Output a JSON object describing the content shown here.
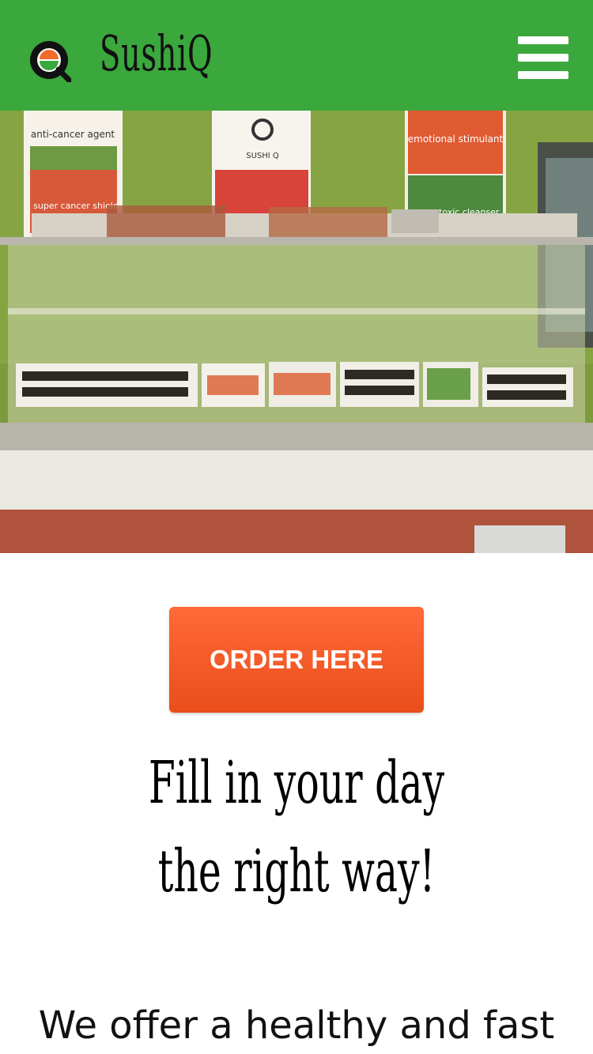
{
  "header": {
    "brand": "SushiQ",
    "logo_icon": "sushi-q-logo-icon",
    "menu_icon": "hamburger-menu-icon",
    "background_color": "#3aa83c"
  },
  "hero": {
    "image": "sushi-display-case-photo",
    "poster_texts": [
      "anti-cancer agent",
      "super cancer shield",
      "SUSHI Q",
      "emotional stimulant",
      "super toxic cleanser"
    ]
  },
  "cta": {
    "label": "ORDER HERE",
    "color": "#f2602b"
  },
  "headline": "Fill in your day the right way!",
  "subtext": "We offer a healthy and fast"
}
